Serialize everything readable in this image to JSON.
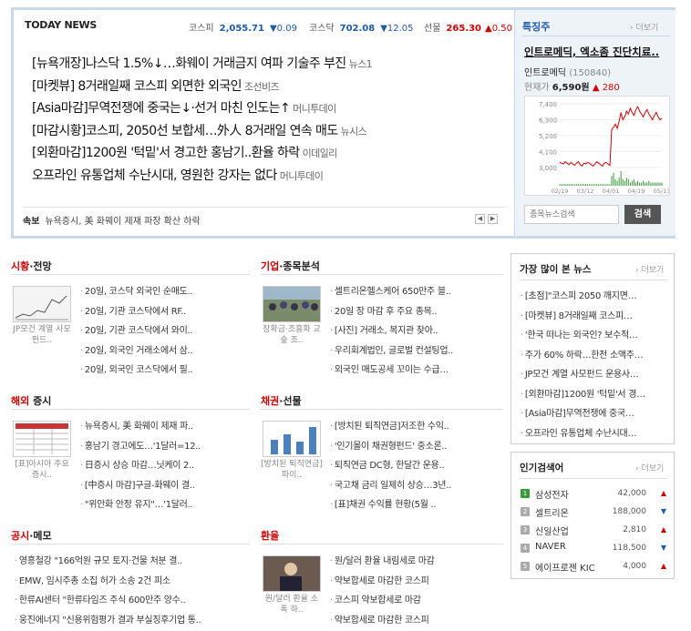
{
  "today": {
    "label": "TODAY NEWS",
    "indices": [
      {
        "name": "코스피",
        "value": "2,055.71",
        "change": "▼0.09",
        "dir": "down"
      },
      {
        "name": "코스닥",
        "value": "702.08",
        "change": "▼12.05",
        "dir": "down"
      },
      {
        "name": "선물",
        "value": "265.30",
        "change": "▲0.50",
        "dir": "up"
      }
    ],
    "headlines": [
      {
        "text": "[뉴욕개장]나스닥 1.5%↓…화웨이 거래금지 여파 기술주 부진",
        "source": "뉴스1"
      },
      {
        "text": "[마켓뷰] 8거래일째 코스피 외면한 외국인",
        "source": "조선비즈"
      },
      {
        "text": "[Asia마감]무역전쟁에 중국는↓·선거 마친 인도는↑",
        "source": "머니투데이"
      },
      {
        "text": "[마감시황]코스피, 2050선 보합세…外人 8거래일 연속 매도",
        "source": "뉴시스"
      },
      {
        "text": "[외환마감]1200원 '턱밑'서 경고한 홍남기..환율 하락",
        "source": "이데일리"
      },
      {
        "text": "오프라인 유통업체 수난시대, 영원한 강자는 없다",
        "source": "머니투데이"
      }
    ],
    "breaking_label": "속보",
    "breaking_text": "뉴욕증시, 美 화웨이 제재 파장 확산 하락",
    "prev": "◀",
    "next": "▶"
  },
  "featured": {
    "title": "특징주",
    "more": "› 더보기",
    "headline": "인트로메딕, 엑소좀 진단치료..",
    "stock_name": "인트로메딕",
    "stock_code": "(150840)",
    "price_label": "현재가",
    "price": "6,590원",
    "change": "▲ 280",
    "search_placeholder": "종목뉴스검색",
    "search_button": "검색"
  },
  "chart_data": {
    "type": "line",
    "x_ticks": [
      "02/19",
      "03/12",
      "04/01",
      "04/19",
      "05/13"
    ],
    "y_ticks": [
      "7,400",
      "6,300",
      "5,200",
      "4,100",
      "3,000"
    ],
    "ylim": [
      3000,
      7400
    ],
    "price": [
      3350,
      3300,
      3250,
      3400,
      3300,
      3200,
      3350,
      3250,
      3150,
      3300,
      3400,
      3200,
      3100,
      3300,
      3250,
      3350,
      3300,
      3200,
      3100,
      3250,
      3400,
      3300,
      3200,
      3100,
      3300,
      3350,
      3250,
      3150,
      5600,
      5800,
      6000,
      5700,
      6200,
      6800,
      6300,
      6500,
      6900,
      6700,
      7100,
      6800,
      6600,
      7000,
      7200,
      6900,
      6700,
      6500,
      6800,
      7000,
      6700,
      6500,
      6300,
      6600,
      6800,
      6500,
      6300,
      6400
    ],
    "volume": [
      1,
      1,
      1,
      1,
      1,
      1,
      1,
      1,
      1,
      1,
      1,
      1,
      1,
      1,
      1,
      1,
      1,
      1,
      1,
      1,
      1,
      1,
      1,
      1,
      1,
      1,
      1,
      1,
      6,
      8,
      4,
      3,
      5,
      9,
      4,
      3,
      5,
      4,
      2,
      3,
      4,
      2,
      3,
      2,
      2,
      3,
      2,
      2,
      3,
      2,
      2,
      2,
      2,
      2,
      2,
      2
    ]
  },
  "sections": {
    "market": {
      "title_a": "시황",
      "title_b": "·전망",
      "caption": "JP모건 계열 사모펀드..",
      "items": [
        "20일, 코스닥 외국인 순매도..",
        "20일, 기관 코스닥에서 RF..",
        "20일, 기관 코스닥에서 와이..",
        "20일, 외국인 거래소에서 삼..",
        "20일, 외국인 코스닥에서 필.."
      ]
    },
    "company": {
      "title_a": "기업",
      "title_b": "·종목",
      "title_c": "분석",
      "caption": "장확금·조흥화 교 숲 조..",
      "items": [
        "셀트리온헬스케어 650만주 블..",
        "20일 장 마감 후 주요 종목..",
        "[사진] 거래소, 복지관 찾아..",
        "우리회계법인, 글로벌 컨설팅업..",
        "외국인 매도공세 꼬이는 수급…"
      ]
    },
    "overseas": {
      "title_a": "해외",
      "title_b": " 증시",
      "caption": "[표]아시아 주요 증시..",
      "items": [
        "뉴욕증시, 美 화웨이 제재 파..",
        "홍남기 경고에도…'1달러=12..",
        "日증시 상승 마감…닛케이 2..",
        "[中증시 마감]구글-화웨이 결..",
        "\"위안화 안정 유지\"…'1달러.."
      ]
    },
    "bond": {
      "title_a": "채권",
      "title_b": "·선물",
      "caption": "[방치된 퇴직연금]파이..",
      "items": [
        "[방치된 퇴직연금]저조한 수익..",
        "'인기몰이 채권형펀드' 중소론..",
        "퇴직연금 DC형, 한달간 운용..",
        "국고채 금리 일제히 상승…3년..",
        "[표]채권 수익률 현황(5월 .."
      ]
    },
    "disclosure": {
      "title_a": "공시",
      "title_b": "·메모",
      "items": [
        "영흥철강 \"166억원 규모 토지·건물 처분 결..",
        "EMW, 임시주총 소집 허가 소송 2건 피소",
        "한류AI센터 \"한류타임즈 주식 600만주 양수..",
        "웅진에너지 \"신용위험평가 결과 부실징후기업 통.."
      ]
    },
    "forex": {
      "title_a": "환율",
      "caption": "원/달러 환율 소 폭 하..",
      "items": [
        "원/달러 환율 내림세로 마감",
        "약보합세로 마감한 코스피",
        "코스피 약보합세로 마감",
        "약보합세로 마감한 코스피"
      ]
    }
  },
  "most_read": {
    "title": "가장 많이 본 뉴스",
    "more": "› 더보기",
    "items": [
      "[초점]\"코스피 2050 깨지면…",
      "[마켓뷰] 8거래일째 코스피…",
      "'한국 떠나는 외국인? 보수적…",
      "주가 60% 하락…한전 소액주…",
      "JP모건 계열 사모펀드 운용사…",
      "[외환마감]1200원 '턱밑'서 경…",
      "[Asia마감]무역전쟁에 중국…",
      "오프라인 유통업체 수난시대…"
    ]
  },
  "popular": {
    "title": "인기검색어",
    "more": "› 더보기",
    "items": [
      {
        "rank": "1",
        "name": "삼성전자",
        "price": "42,000",
        "dir": "up"
      },
      {
        "rank": "2",
        "name": "셀트리온",
        "price": "188,000",
        "dir": "down"
      },
      {
        "rank": "3",
        "name": "신일산업",
        "price": "2,810",
        "dir": "up"
      },
      {
        "rank": "4",
        "name": "NAVER",
        "price": "118,500",
        "dir": "down"
      },
      {
        "rank": "5",
        "name": "에이프로젠 KIC",
        "price": "4,000",
        "dir": "up"
      }
    ]
  },
  "colors": {
    "accent_red": "#d40000",
    "accent_blue": "#1e5aa8",
    "border": "#c9d9ea"
  }
}
